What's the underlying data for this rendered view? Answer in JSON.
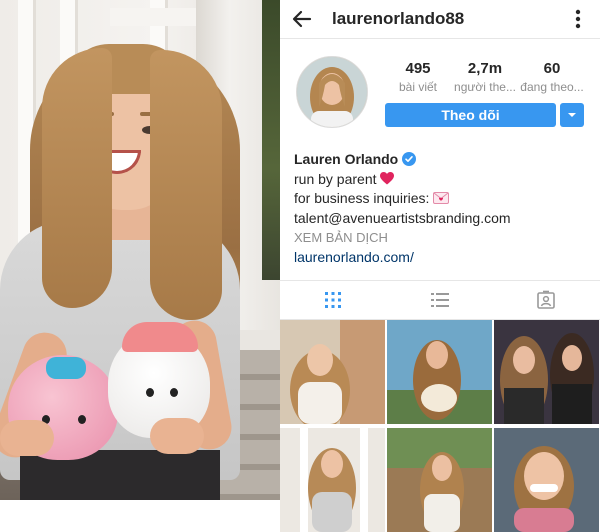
{
  "profile": {
    "username": "laurenorlando88",
    "stats": [
      {
        "value": "495",
        "label": "bài viết"
      },
      {
        "value": "2,7m",
        "label": "người the..."
      },
      {
        "value": "60",
        "label": "đang theo..."
      }
    ],
    "follow_label": "Theo dõi",
    "name": "Lauren Orlando",
    "bio_lines": [
      "run by parent",
      "for business inquiries:",
      "talent@avenueartistsbranding.com"
    ],
    "translate_label": "XEM BẢN DỊCH",
    "website": "laurenorlando.com/"
  },
  "icons": {
    "back": "arrow-left-icon",
    "more": "more-vertical-icon",
    "verified": "verified-badge-icon",
    "heart": "heart-emoji",
    "envelope": "love-letter-emoji",
    "tabs": [
      "grid-icon",
      "list-icon",
      "tagged-icon"
    ]
  },
  "colors": {
    "accent": "#3897f0",
    "link": "#003569",
    "active_tab": "#3897f0"
  },
  "grid_posts": 6
}
